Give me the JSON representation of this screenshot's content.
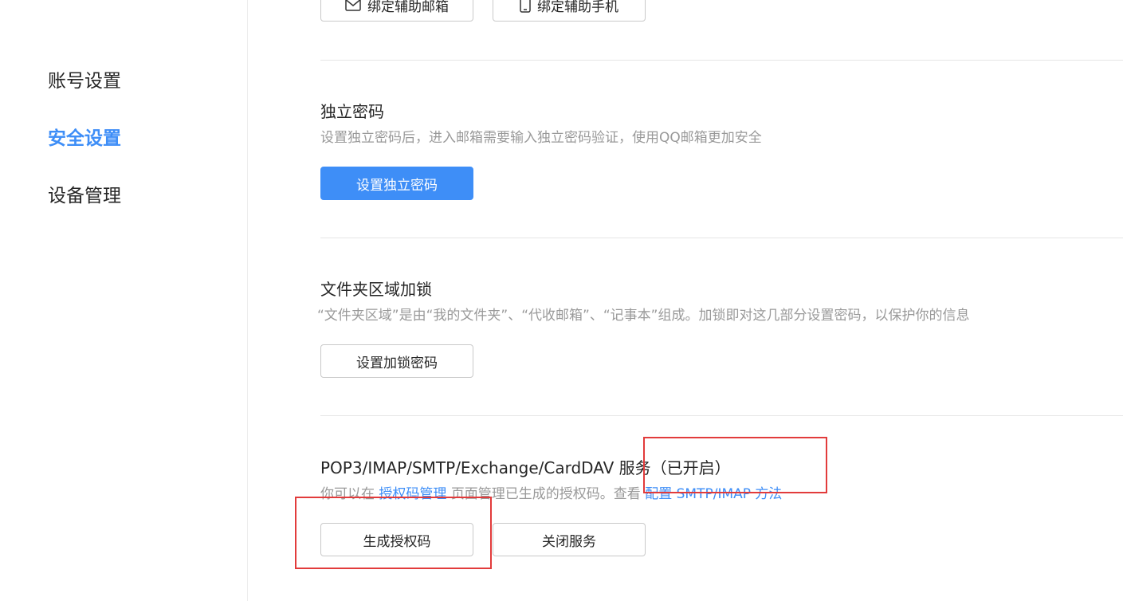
{
  "sidebar": {
    "items": [
      {
        "label": "账号设置"
      },
      {
        "label": "安全设置"
      },
      {
        "label": "设备管理"
      }
    ]
  },
  "top_buttons": {
    "bind_email": "绑定辅助邮箱",
    "bind_phone": "绑定辅助手机"
  },
  "independent_password": {
    "title": "独立密码",
    "desc": "设置独立密码后，进入邮箱需要输入独立密码验证，使用QQ邮箱更加安全",
    "button": "设置独立密码"
  },
  "folder_lock": {
    "title": "文件夹区域加锁",
    "desc": "“文件夹区域”是由“我的文件夹”、“代收邮箱”、“记事本”组成。加锁即对这几部分设置密码，以保护你的信息",
    "button": "设置加锁密码"
  },
  "pop3_service": {
    "title": "POP3/IMAP/SMTP/Exchange/CardDAV 服务",
    "status": "（已开启）",
    "desc_prefix": "你可以在",
    "desc_link1": "授权码管理",
    "desc_middle": "页面管理已生成的授权码。查看",
    "desc_link2": "配置 SMTP/IMAP 方法",
    "button_generate": "生成授权码",
    "button_close": "关闭服务"
  },
  "colors": {
    "accent": "#3e8ef7",
    "annotation": "#e23b3b"
  },
  "icons": [
    "mail-icon",
    "phone-icon"
  ]
}
